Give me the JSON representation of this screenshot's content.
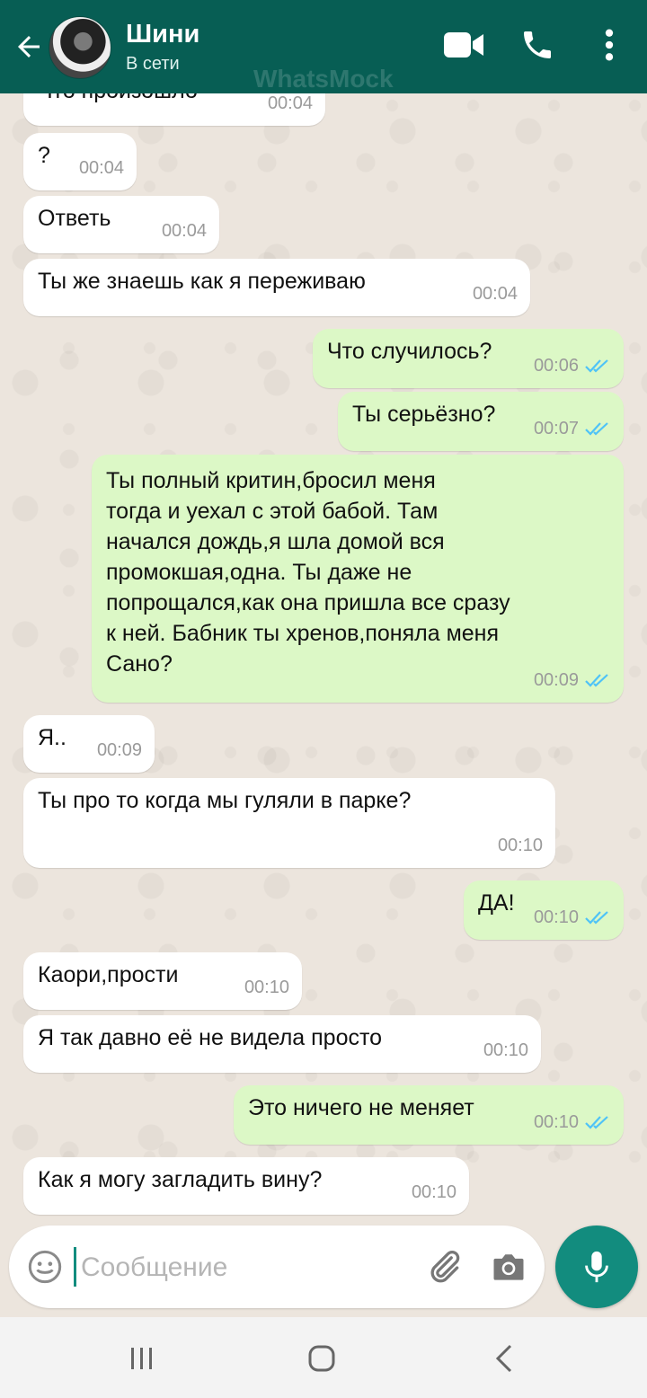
{
  "header": {
    "contact_name": "Шини",
    "status": "В сети",
    "watermark": "WhatsMock",
    "icons": [
      "back-arrow-icon",
      "video-call-icon",
      "phone-call-icon",
      "more-vert-icon"
    ]
  },
  "messages": [
    {
      "direction": "in",
      "text": "Что произошло",
      "time": "00:04"
    },
    {
      "direction": "in",
      "text": "?",
      "time": "00:04"
    },
    {
      "direction": "in",
      "text": "Ответь",
      "time": "00:04"
    },
    {
      "direction": "in",
      "text": "Ты же знаешь как я переживаю",
      "time": "00:04"
    },
    {
      "direction": "out",
      "text": "Что случилось?",
      "time": "00:06",
      "status": "read"
    },
    {
      "direction": "out",
      "text": "Ты серьёзно?",
      "time": "00:07",
      "status": "read"
    },
    {
      "direction": "out",
      "text": "Ты полный критин,бросил меня\nтогда и уехал с этой бабой. Там\nначался дождь,я шла домой вся\nпромокшая,одна. Ты даже не\nпопрощался,как она пришла все сразу\nк ней. Бабник ты хренов,поняла меня\nСано?",
      "time": "00:09",
      "status": "read"
    },
    {
      "direction": "in",
      "text": "Я..",
      "time": "00:09"
    },
    {
      "direction": "in",
      "text": "Ты про то когда мы гуляли в парке?",
      "time": "00:10"
    },
    {
      "direction": "out",
      "text": "ДА!",
      "time": "00:10",
      "status": "read"
    },
    {
      "direction": "in",
      "text": "Каори,прости",
      "time": "00:10"
    },
    {
      "direction": "in",
      "text": "Я так давно её не видела просто",
      "time": "00:10"
    },
    {
      "direction": "out",
      "text": "Это ничего не меняет",
      "time": "00:10",
      "status": "read"
    },
    {
      "direction": "in",
      "text": "Как я могу загладить вину?",
      "time": "00:10"
    }
  ],
  "composer": {
    "placeholder": "Сообщение",
    "value": "",
    "icons": [
      "emoji-icon",
      "attach-icon",
      "camera-icon",
      "mic-icon"
    ]
  },
  "colors": {
    "header_bg": "#075e54",
    "accent": "#128c7e",
    "incoming_bubble": "#ffffff",
    "outgoing_bubble": "#dcf8c6",
    "read_ticks": "#4fc3f7",
    "chat_bg": "#ece5dd"
  }
}
